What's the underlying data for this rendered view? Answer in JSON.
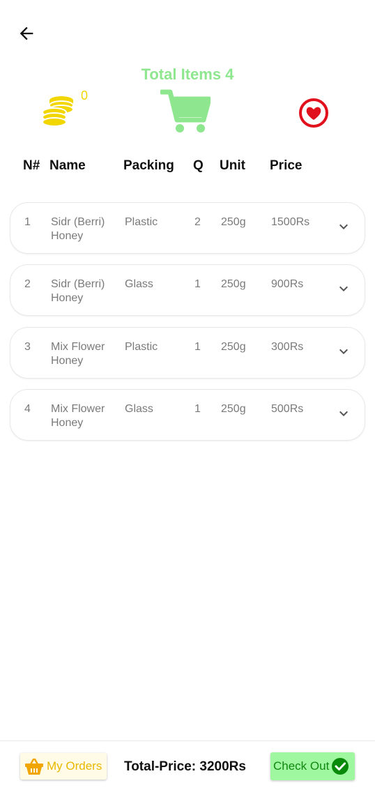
{
  "header": {
    "back_icon": "arrow-left-icon",
    "total_items_label": "Total Items 4"
  },
  "summary": {
    "coins_icon": "coins-icon",
    "coin_count": "0",
    "cart_icon": "shopping-cart-icon",
    "wishlist_icon": "heart-icon"
  },
  "table": {
    "headers": [
      "N#",
      "Name",
      "Packing",
      "Q",
      "Unit",
      "Price"
    ],
    "rows": [
      {
        "num": "1",
        "name": "Sidr (Berri) Honey",
        "packing": "Plastic",
        "q": "2",
        "unit": "250g",
        "price": "1500Rs"
      },
      {
        "num": "2",
        "name": "Sidr (Berri) Honey",
        "packing": "Glass",
        "q": "1",
        "unit": "250g",
        "price": "900Rs"
      },
      {
        "num": "3",
        "name": "Mix Flower Honey",
        "packing": "Plastic",
        "q": "1",
        "unit": "250g",
        "price": "300Rs"
      },
      {
        "num": "4",
        "name": "Mix Flower Honey",
        "packing": "Glass",
        "q": "1",
        "unit": "250g",
        "price": "500Rs"
      }
    ]
  },
  "footer": {
    "my_orders_label": "My Orders",
    "total_price_label": "Total-Price: 3200Rs",
    "checkout_label": "Check Out"
  },
  "colors": {
    "accent_green": "#8ee68e",
    "coin_yellow": "#f1d600",
    "heart_red": "#e0101c",
    "checkout_bg": "#9ff79f"
  }
}
